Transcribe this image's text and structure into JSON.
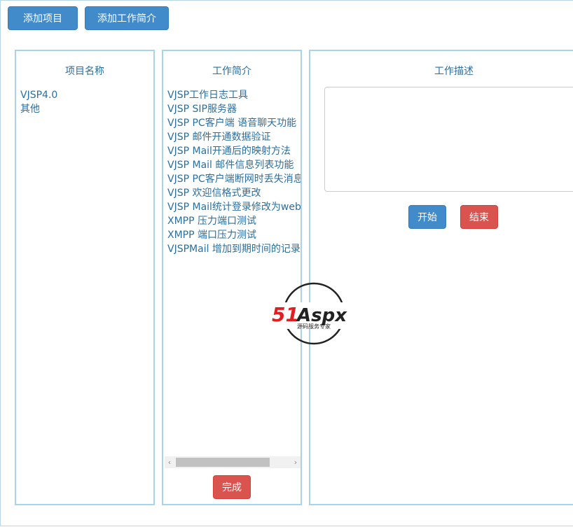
{
  "toolbar": {
    "add_project_label": "添加项目",
    "add_summary_label": "添加工作简介"
  },
  "projects": {
    "title": "项目名称",
    "items": [
      "VJSP4.0",
      "其他"
    ]
  },
  "summaries": {
    "title": "工作简介",
    "items": [
      "VJSP工作日志工具",
      "VJSP SIP服务器",
      "VJSP PC客户端 语音聊天功能",
      "VJSP 邮件开通数据验证",
      "VJSP Mail开通后的映射方法",
      "VJSP Mail 邮件信息列表功能",
      "VJSP PC客户端断网时丢失消息",
      "VJSP 欢迎信格式更改",
      "VJSP Mail统计登录修改为web",
      "XMPP 压力端口测试",
      "XMPP 端口压力测试",
      "VJSPMail 增加到期时间的记录"
    ],
    "done_label": "完成"
  },
  "description": {
    "title": "工作描述",
    "value": "",
    "start_label": "开始",
    "end_label": "结束"
  },
  "watermark": {
    "brand": "51Aspx",
    "tagline": "源码服务专家"
  },
  "colors": {
    "primary": "#428bca",
    "danger": "#d9534f",
    "panel_border": "#a8d4ea",
    "text": "#2a6fa0"
  }
}
